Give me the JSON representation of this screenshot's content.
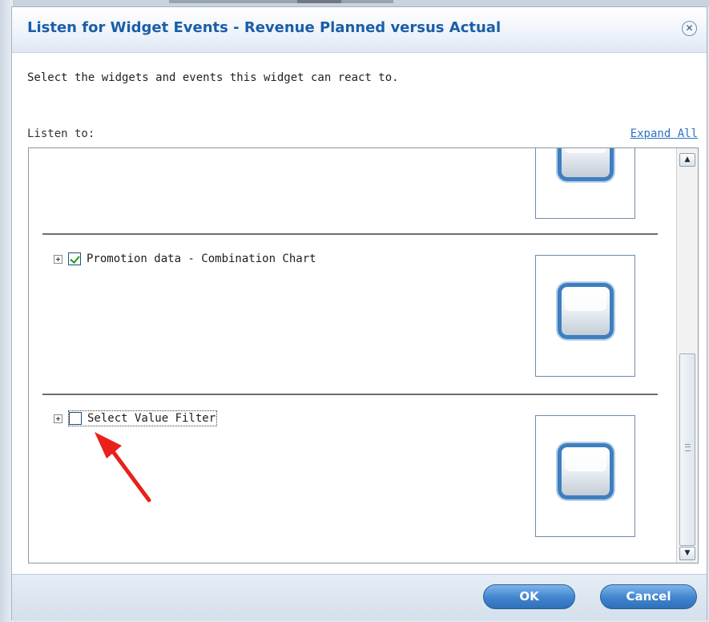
{
  "dialog": {
    "title": "Listen for Widget Events - Revenue Planned versus Actual",
    "close_icon": "close-circle-icon",
    "instructions": "Select the widgets and events this widget can react to.",
    "listen_to_label": "Listen to:",
    "expand_all_label": "Expand All"
  },
  "widget_list": {
    "items": [
      {
        "label": "",
        "checked": false,
        "partially_visible": true
      },
      {
        "label": "Promotion data - Combination Chart",
        "checked": true
      },
      {
        "label": "Select Value Filter",
        "checked": false,
        "focused": true
      }
    ]
  },
  "annotation": {
    "arrow_color": "#e8211b"
  },
  "footer": {
    "ok_label": "OK",
    "cancel_label": "Cancel"
  },
  "colors": {
    "title": "#1a5ea8",
    "link": "#2a72c4",
    "button": "#3f84cf"
  }
}
